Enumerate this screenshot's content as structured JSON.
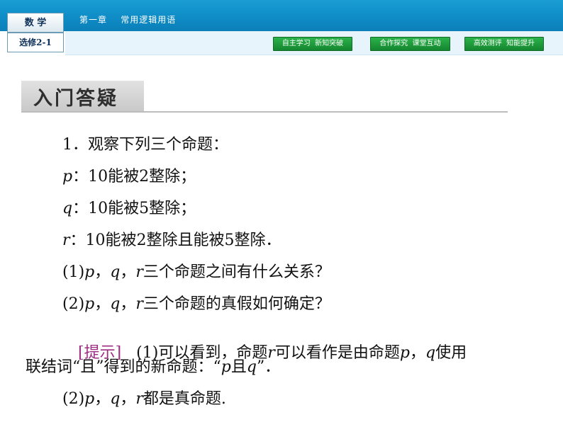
{
  "header": {
    "subject": "数 学",
    "course": "选修2-1",
    "chapter": "第一章    常用逻辑用语",
    "nav_buttons": [
      "自主学习  新知突破",
      "合作探究  课堂互动",
      "高效测评  知能提升"
    ]
  },
  "section": {
    "title": "入门答疑"
  },
  "content": {
    "q_intro": "1．观察下列三个命题：",
    "p_var": "p",
    "p_text": "：10能被2整除；",
    "q_var": "q",
    "q_text": "：10能被5整除；",
    "r_var": "r",
    "r_text": "：10能被2整除且能被5整除．",
    "q1_num": "(1)",
    "q1_p": "p",
    "q1_sep1": "，",
    "q1_q": "q",
    "q1_sep2": "，",
    "q1_r": "r",
    "q1_text": "三个命题之间有什么关系？",
    "q2_num": "(2)",
    "q2_p": "p",
    "q2_sep1": "，",
    "q2_q": "q",
    "q2_sep2": "，",
    "q2_r": "r",
    "q2_text": "三个命题的真假如何确定？",
    "hint_label": "[提示]",
    "hint_a": "   (1)可以看到，命题",
    "hint_r": "r",
    "hint_b": "可以看作是由命题",
    "hint_p": "p",
    "hint_c": "，",
    "hint_q": "q",
    "hint_d": "使用",
    "hint2_a": "联结词“且”得到的新命题：“",
    "hint2_p": "p",
    "hint2_b": "且",
    "hint2_q": "q",
    "hint2_c": "”．",
    "ans2_num": "(2)",
    "ans2_p": "p",
    "ans2_sep1": "，",
    "ans2_q": "q",
    "ans2_sep2": "，",
    "ans2_r": "r",
    "ans2_text": "都是真命题."
  },
  "colors": {
    "header_blue": "#0f8cc6",
    "nav_green": "#1a9a3a",
    "hint_purple": "#9b2d83"
  }
}
